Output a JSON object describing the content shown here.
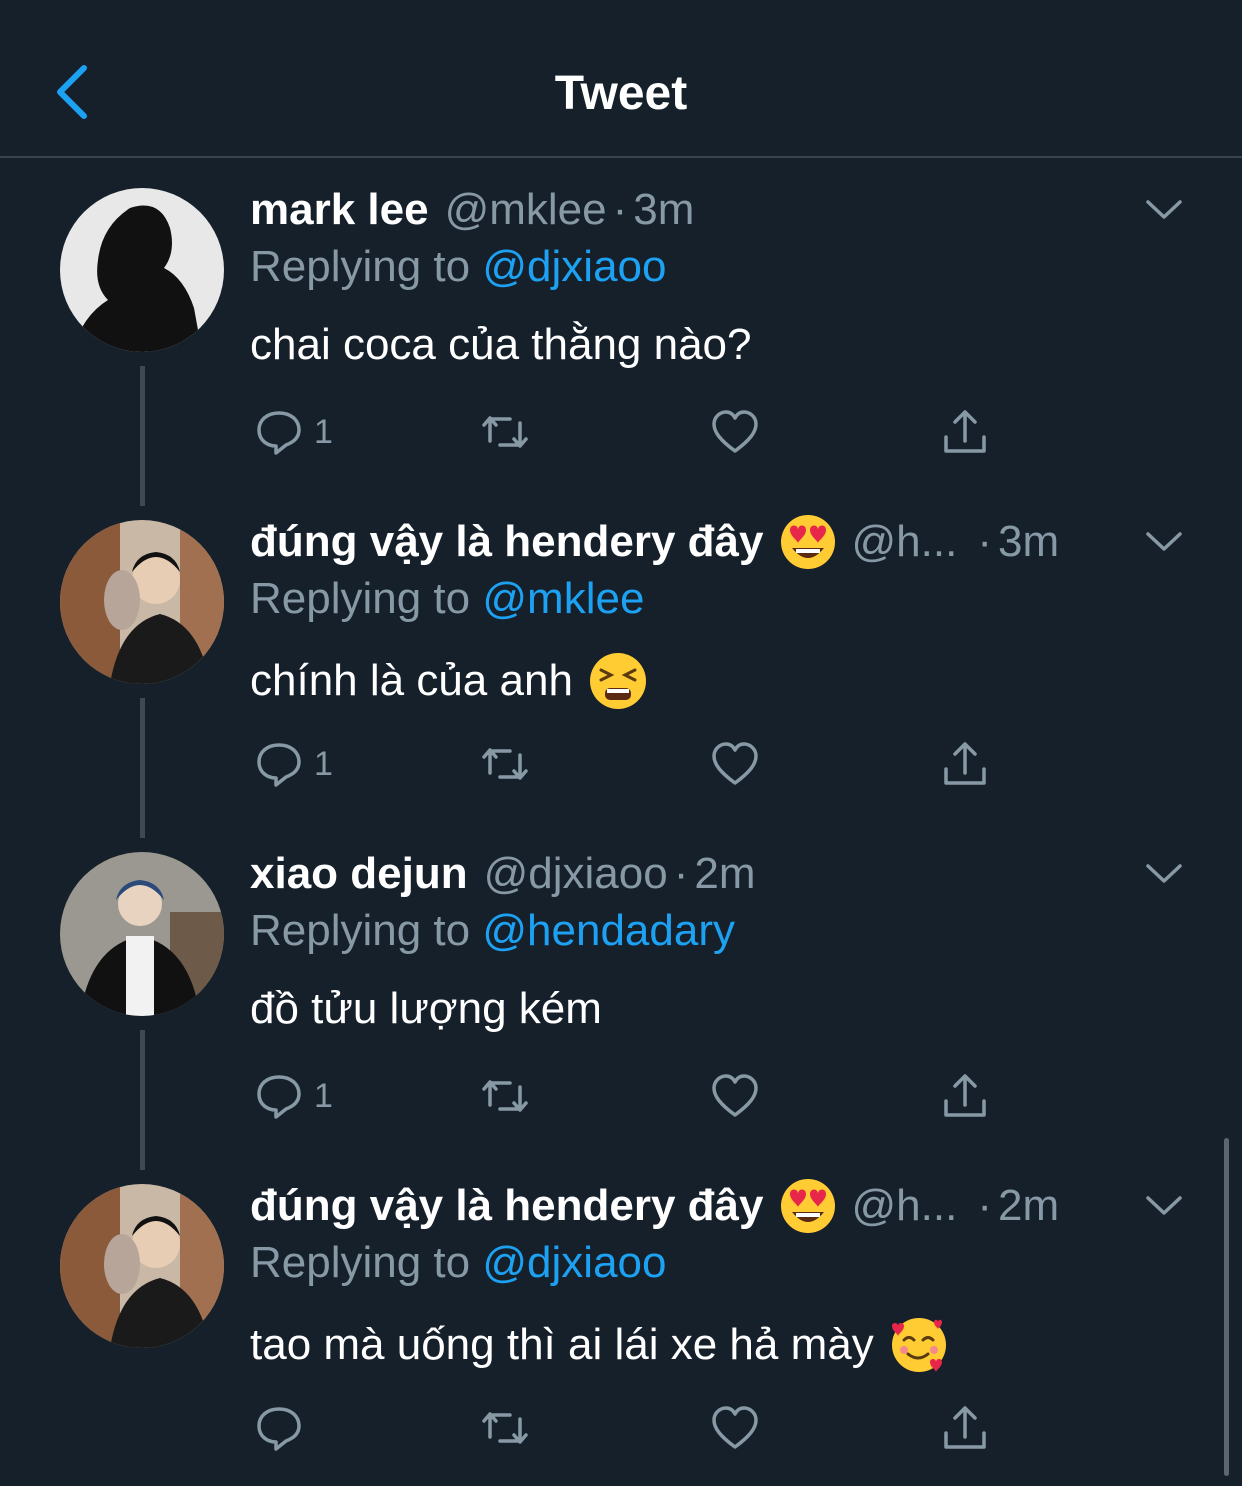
{
  "header": {
    "title": "Tweet"
  },
  "tweets": [
    {
      "name": "mark lee",
      "handle": "@mklee",
      "dot": "·",
      "time": "3m",
      "replying_prefix": "Replying to",
      "replying_to": "@djxiaoo",
      "text": "chai coca của thằng nào?",
      "reply_count": "1",
      "has_name_emoji": false,
      "text_emoji": "",
      "avatar_icon": "avatar-silhouette"
    },
    {
      "name": "đúng vậy là hendery đây",
      "handle": "@h...",
      "dot": "·",
      "time": "3m",
      "replying_prefix": "Replying to",
      "replying_to": "@mklee",
      "text": "chính là của anh",
      "reply_count": "1",
      "has_name_emoji": true,
      "name_emoji": "heart-eyes-emoji",
      "text_emoji": "tired-face-emoji",
      "avatar_icon": "avatar-person-with-cat"
    },
    {
      "name": "xiao dejun",
      "handle": "@djxiaoo",
      "dot": "·",
      "time": "2m",
      "replying_prefix": "Replying to",
      "replying_to": "@hendadary",
      "text": "đồ tửu lượng kém",
      "reply_count": "1",
      "has_name_emoji": false,
      "text_emoji": "",
      "avatar_icon": "avatar-person-jacket"
    },
    {
      "name": "đúng vậy là hendery đây",
      "handle": "@h...",
      "dot": "·",
      "time": "2m",
      "replying_prefix": "Replying to",
      "replying_to": "@djxiaoo",
      "text": "tao mà uống thì ai lái xe hả mày",
      "reply_count": "",
      "has_name_emoji": true,
      "name_emoji": "heart-eyes-emoji",
      "text_emoji": "smiling-face-with-hearts-emoji",
      "avatar_icon": "avatar-person-with-cat"
    }
  ],
  "colors": {
    "background": "#15202b",
    "accent": "#1da1f2",
    "secondary_text": "#8899a6",
    "divider": "#38444d"
  }
}
